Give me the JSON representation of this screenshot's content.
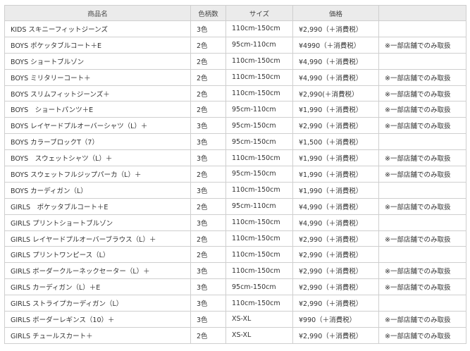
{
  "headers": [
    "商品名",
    "色柄数",
    "サイズ",
    "価格",
    ""
  ],
  "rows": [
    [
      "KIDS スキニーフィットジーンズ",
      "3色",
      "110cm-150cm",
      "¥2,990（＋消費税）",
      ""
    ],
    [
      "BOYS ポケッタブルコート＋E",
      "2色",
      "95cm-110cm",
      "¥4990（＋消費税）",
      "※一部店舗でのみ取扱"
    ],
    [
      "BOYS ショートブルゾン",
      "2色",
      "110cm-150cm",
      "¥4,990（＋消費税）",
      ""
    ],
    [
      "BOYS ミリタリーコート＋",
      "2色",
      "110cm-150cm",
      "¥4,990（＋消費税）",
      "※一部店舗でのみ取扱"
    ],
    [
      "BOYS スリムフィットジーンズ＋",
      "2色",
      "110cm-150cm",
      "¥2,990(＋消費税）",
      "※一部店舗でのみ取扱"
    ],
    [
      "BOYS　ショートパンツ＋E",
      "2色",
      "95cm-110cm",
      "¥1,990（＋消費税）",
      "※一部店舗でのみ取扱"
    ],
    [
      "BOYS レイヤードプルオーバーシャツ（L）＋",
      "3色",
      "95cm-150cm",
      "¥2,990（＋消費税）",
      "※一部店舗でのみ取扱"
    ],
    [
      "BOYS カラーブロックT（7）",
      "3色",
      "95cm-150cm",
      "¥1,500（＋消費税）",
      ""
    ],
    [
      "BOYS　スウェットシャツ（L）＋",
      "3色",
      "110cm-150cm",
      "¥1,990（＋消費税）",
      "※一部店舗でのみ取扱"
    ],
    [
      "BOYS スウェットフルジップパーカ（L）＋",
      "2色",
      "95cm-150cm",
      "¥1,990（＋消費税）",
      "※一部店舗でのみ取扱"
    ],
    [
      "BOYS カーディガン（L）",
      "3色",
      "110cm-150cm",
      "¥1,990（＋消費税）",
      ""
    ],
    [
      "GIRLS　ポケッタブルコート＋E",
      "2色",
      "95cm-110cm",
      "¥4,990（＋消費税）",
      "※一部店舗でのみ取扱"
    ],
    [
      "GIRLS プリントショートブルゾン",
      "3色",
      "110cm-150cm",
      "¥4,990（＋消費税）",
      ""
    ],
    [
      "GIRLS レイヤードプルオーバーブラウス（L）＋",
      "2色",
      "110cm-150cm",
      "¥2,990（＋消費税）",
      "※一部店舗でのみ取扱"
    ],
    [
      "GIRLS プリントワンピース（L）",
      "2色",
      "110cm-150cm",
      "¥2,990（＋消費税）",
      ""
    ],
    [
      "GIRLS ボーダークルーネックセーター（L）＋",
      "3色",
      "110cm-150cm",
      "¥2,990（＋消費税）",
      "※一部店舗でのみ取扱"
    ],
    [
      "GIRLS カーディガン（L）＋E",
      "3色",
      "95cm-150cm",
      "¥2,990（＋消費税）",
      "※一部店舗でのみ取扱"
    ],
    [
      "GIRLS ストライプカーディガン（L）",
      "3色",
      "110cm-150cm",
      "¥2,990（＋消費税）",
      ""
    ],
    [
      "GIRLS ボーダーレギンス（10）＋",
      "3色",
      "XS-XL",
      "¥990（＋消費税）",
      "※一部店舗でのみ取扱"
    ],
    [
      "GIRLS チュールスカート＋",
      "2色",
      "XS-XL",
      "¥2,990（＋消費税）",
      "※一部店舗でのみ取扱"
    ]
  ]
}
